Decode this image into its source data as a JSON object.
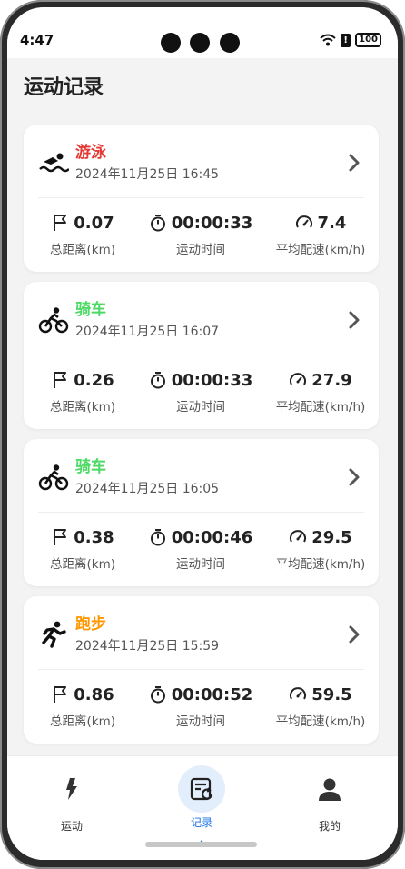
{
  "status_bar": {
    "time": "4:47",
    "battery": "100",
    "alert": "!"
  },
  "page": {
    "title": "运动记录"
  },
  "stat_labels": {
    "distance": "总距离(km)",
    "duration": "运动时间",
    "pace": "平均配速(km/h)"
  },
  "records": [
    {
      "sport": "游泳",
      "icon": "swim-icon",
      "color": "#e53935",
      "date": "2024年11月25日 16:45",
      "distance": "0.07",
      "duration": "00:00:33",
      "pace": "7.4"
    },
    {
      "sport": "骑车",
      "icon": "bike-icon",
      "color": "#4cd964",
      "date": "2024年11月25日 16:07",
      "distance": "0.26",
      "duration": "00:00:33",
      "pace": "27.9"
    },
    {
      "sport": "骑车",
      "icon": "bike-icon",
      "color": "#4cd964",
      "date": "2024年11月25日 16:05",
      "distance": "0.38",
      "duration": "00:00:46",
      "pace": "29.5"
    },
    {
      "sport": "跑步",
      "icon": "run-icon",
      "color": "#ff9800",
      "date": "2024年11月25日 15:59",
      "distance": "0.86",
      "duration": "00:00:52",
      "pace": "59.5"
    }
  ],
  "nav": {
    "items": [
      {
        "label": "运动",
        "icon": "lightning-icon",
        "active": false
      },
      {
        "label": "记录",
        "icon": "record-icon",
        "active": true
      },
      {
        "label": "我的",
        "icon": "user-icon",
        "active": false
      }
    ],
    "active_color": "#1a73e8"
  }
}
